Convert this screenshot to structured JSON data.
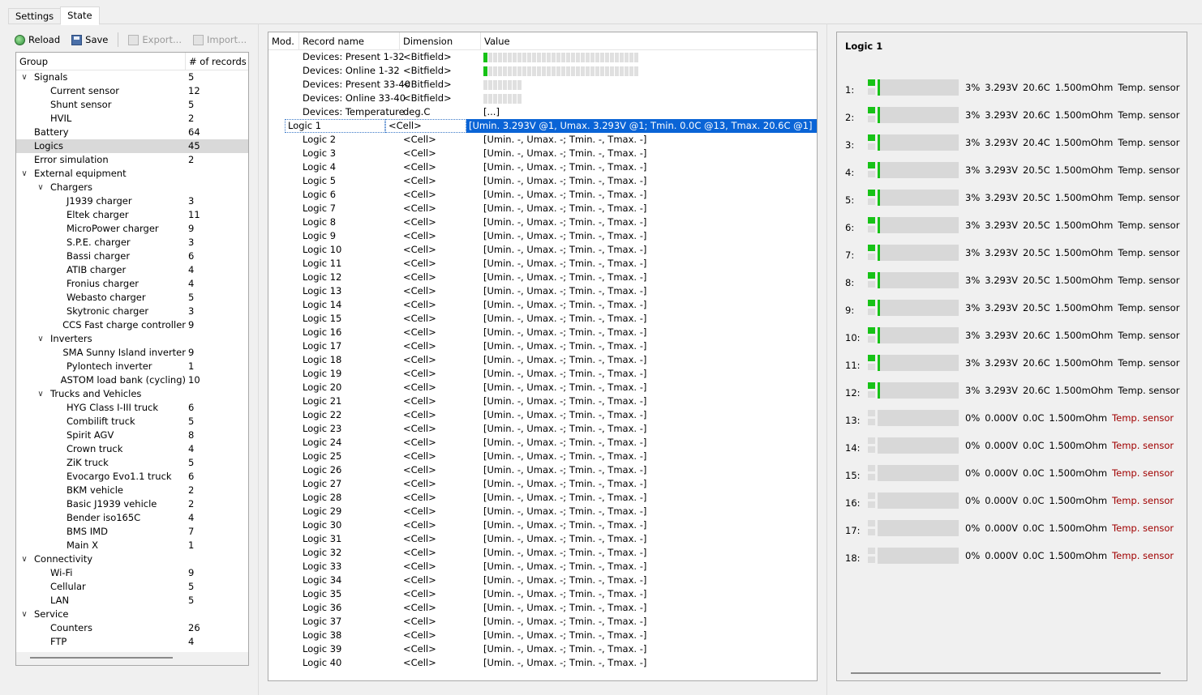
{
  "tabs": [
    {
      "label": "Settings"
    },
    {
      "label": "State"
    }
  ],
  "toolbar": {
    "reload": "Reload",
    "save": "Save",
    "export": "Export...",
    "import": "Import..."
  },
  "group_panel": {
    "col_group": "Group",
    "col_records": "# of records",
    "rows": [
      {
        "name": "Signals",
        "count": "5",
        "level": 0,
        "expander": "open"
      },
      {
        "name": "Current sensor",
        "count": "12",
        "level": 1
      },
      {
        "name": "Shunt sensor",
        "count": "5",
        "level": 1
      },
      {
        "name": "HVIL",
        "count": "2",
        "level": 1
      },
      {
        "name": "Battery",
        "count": "64",
        "level": 0
      },
      {
        "name": "Logics",
        "count": "45",
        "level": 0,
        "selected": true
      },
      {
        "name": "Error simulation",
        "count": "2",
        "level": 0
      },
      {
        "name": "External equipment",
        "count": "",
        "level": 0,
        "expander": "open"
      },
      {
        "name": "Chargers",
        "count": "",
        "level": 1,
        "expander": "open"
      },
      {
        "name": "J1939 charger",
        "count": "3",
        "level": 2
      },
      {
        "name": "Eltek charger",
        "count": "11",
        "level": 2
      },
      {
        "name": "MicroPower charger",
        "count": "9",
        "level": 2
      },
      {
        "name": "S.P.E. charger",
        "count": "3",
        "level": 2
      },
      {
        "name": "Bassi charger",
        "count": "6",
        "level": 2
      },
      {
        "name": "ATIB charger",
        "count": "4",
        "level": 2
      },
      {
        "name": "Fronius charger",
        "count": "4",
        "level": 2
      },
      {
        "name": "Webasto charger",
        "count": "5",
        "level": 2
      },
      {
        "name": "Skytronic charger",
        "count": "3",
        "level": 2
      },
      {
        "name": "CCS Fast charge controller",
        "count": "9",
        "level": 2
      },
      {
        "name": "Inverters",
        "count": "",
        "level": 1,
        "expander": "open"
      },
      {
        "name": "SMA Sunny Island inverter",
        "count": "9",
        "level": 2
      },
      {
        "name": "Pylontech inverter",
        "count": "1",
        "level": 2
      },
      {
        "name": "ASTOM load bank (cycling)",
        "count": "10",
        "level": 2
      },
      {
        "name": "Trucks and Vehicles",
        "count": "",
        "level": 1,
        "expander": "open"
      },
      {
        "name": "HYG Class I-III truck",
        "count": "6",
        "level": 2
      },
      {
        "name": "Combilift truck",
        "count": "5",
        "level": 2
      },
      {
        "name": "Spirit AGV",
        "count": "8",
        "level": 2
      },
      {
        "name": "Crown truck",
        "count": "4",
        "level": 2
      },
      {
        "name": "ZiK truck",
        "count": "5",
        "level": 2
      },
      {
        "name": "Evocargo Evo1.1 truck",
        "count": "6",
        "level": 2
      },
      {
        "name": "BKM vehicle",
        "count": "2",
        "level": 2
      },
      {
        "name": "Basic J1939 vehicle",
        "count": "2",
        "level": 2
      },
      {
        "name": "Bender iso165C",
        "count": "4",
        "level": 2
      },
      {
        "name": "BMS IMD",
        "count": "7",
        "level": 2
      },
      {
        "name": "Main X",
        "count": "1",
        "level": 2
      },
      {
        "name": "Connectivity",
        "count": "",
        "level": 0,
        "expander": "open"
      },
      {
        "name": "Wi-Fi",
        "count": "9",
        "level": 1
      },
      {
        "name": "Cellular",
        "count": "5",
        "level": 1
      },
      {
        "name": "LAN",
        "count": "5",
        "level": 1
      },
      {
        "name": "Service",
        "count": "",
        "level": 0,
        "expander": "open"
      },
      {
        "name": "Counters",
        "count": "26",
        "level": 1
      },
      {
        "name": "FTP",
        "count": "4",
        "level": 1
      }
    ]
  },
  "records": {
    "col_mod": "Mod.",
    "col_name": "Record name",
    "col_dim": "Dimension",
    "col_value": "Value",
    "bitfields": [
      {
        "name": "Devices: Present 1-32",
        "dim": "<Bitfield>",
        "bits": 32,
        "on": [
          0
        ]
      },
      {
        "name": "Devices: Online 1-32",
        "dim": "<Bitfield>",
        "bits": 32,
        "on": [
          0
        ]
      },
      {
        "name": "Devices: Present 33-40",
        "dim": "<Bitfield>",
        "bits": 8,
        "on": []
      },
      {
        "name": "Devices: Online 33-40",
        "dim": "<Bitfield>",
        "bits": 8,
        "on": []
      }
    ],
    "temperature": {
      "name": "Devices: Temperature",
      "dim": "deg.C",
      "value": "[...]"
    },
    "selected_logic": {
      "name": "Logic 1",
      "dim": "<Cell>",
      "value": "[Umin. 3.293V @1, Umax. 3.293V @1; Tmin. 0.0C @13, Tmax. 20.6C @1]"
    },
    "cell_dim": "<Cell>",
    "empty_value": "[Umin. -, Umax. -; Tmin. -, Tmax. -]",
    "logic_prefix": "Logic ",
    "logic_from": 2,
    "logic_to": 40
  },
  "logic_panel": {
    "title": "Logic 1",
    "sensor_label": "Temp. sensor",
    "cells": [
      {
        "idx": "1:",
        "pct": "3%",
        "volt": "3.293V",
        "temp": "20.6C",
        "res": "1.500mOhm",
        "ok": true,
        "fill": 0.03
      },
      {
        "idx": "2:",
        "pct": "3%",
        "volt": "3.293V",
        "temp": "20.6C",
        "res": "1.500mOhm",
        "ok": true,
        "fill": 0.03
      },
      {
        "idx": "3:",
        "pct": "3%",
        "volt": "3.293V",
        "temp": "20.4C",
        "res": "1.500mOhm",
        "ok": true,
        "fill": 0.03
      },
      {
        "idx": "4:",
        "pct": "3%",
        "volt": "3.293V",
        "temp": "20.5C",
        "res": "1.500mOhm",
        "ok": true,
        "fill": 0.03
      },
      {
        "idx": "5:",
        "pct": "3%",
        "volt": "3.293V",
        "temp": "20.5C",
        "res": "1.500mOhm",
        "ok": true,
        "fill": 0.03
      },
      {
        "idx": "6:",
        "pct": "3%",
        "volt": "3.293V",
        "temp": "20.5C",
        "res": "1.500mOhm",
        "ok": true,
        "fill": 0.03
      },
      {
        "idx": "7:",
        "pct": "3%",
        "volt": "3.293V",
        "temp": "20.5C",
        "res": "1.500mOhm",
        "ok": true,
        "fill": 0.03
      },
      {
        "idx": "8:",
        "pct": "3%",
        "volt": "3.293V",
        "temp": "20.5C",
        "res": "1.500mOhm",
        "ok": true,
        "fill": 0.03
      },
      {
        "idx": "9:",
        "pct": "3%",
        "volt": "3.293V",
        "temp": "20.5C",
        "res": "1.500mOhm",
        "ok": true,
        "fill": 0.03
      },
      {
        "idx": "10:",
        "pct": "3%",
        "volt": "3.293V",
        "temp": "20.6C",
        "res": "1.500mOhm",
        "ok": true,
        "fill": 0.03
      },
      {
        "idx": "11:",
        "pct": "3%",
        "volt": "3.293V",
        "temp": "20.6C",
        "res": "1.500mOhm",
        "ok": true,
        "fill": 0.03
      },
      {
        "idx": "12:",
        "pct": "3%",
        "volt": "3.293V",
        "temp": "20.6C",
        "res": "1.500mOhm",
        "ok": true,
        "fill": 0.03
      },
      {
        "idx": "13:",
        "pct": "0%",
        "volt": "0.000V",
        "temp": "0.0C",
        "res": "1.500mOhm",
        "ok": false,
        "fill": 0
      },
      {
        "idx": "14:",
        "pct": "0%",
        "volt": "0.000V",
        "temp": "0.0C",
        "res": "1.500mOhm",
        "ok": false,
        "fill": 0
      },
      {
        "idx": "15:",
        "pct": "0%",
        "volt": "0.000V",
        "temp": "0.0C",
        "res": "1.500mOhm",
        "ok": false,
        "fill": 0
      },
      {
        "idx": "16:",
        "pct": "0%",
        "volt": "0.000V",
        "temp": "0.0C",
        "res": "1.500mOhm",
        "ok": false,
        "fill": 0
      },
      {
        "idx": "17:",
        "pct": "0%",
        "volt": "0.000V",
        "temp": "0.0C",
        "res": "1.500mOhm",
        "ok": false,
        "fill": 0
      },
      {
        "idx": "18:",
        "pct": "0%",
        "volt": "0.000V",
        "temp": "0.0C",
        "res": "1.500mOhm",
        "ok": false,
        "fill": 0
      }
    ]
  },
  "colors": {
    "accent": "#0a64d6",
    "ok_green": "#17c217",
    "error_red": "#a00000"
  }
}
